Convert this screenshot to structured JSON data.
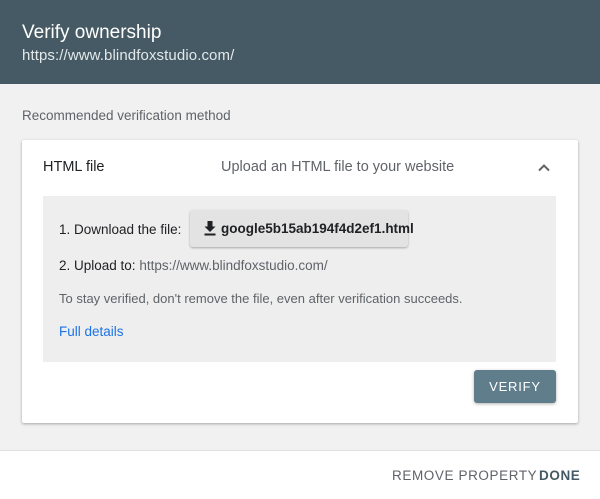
{
  "dialog": {
    "title": "Verify ownership",
    "property_url": "https://www.blindfoxstudio.com/"
  },
  "recommended_label": "Recommended verification method",
  "method": {
    "name": "HTML file",
    "description": "Upload an HTML file to your website",
    "expanded": true,
    "collapse_icon": "chevron-up-icon",
    "step1_label": "1. Download the file:",
    "download_file": "google5b15ab194f4d2ef1.html",
    "download_icon": "download-icon",
    "step2_label": "2. Upload to:",
    "step2_url": "https://www.blindfoxstudio.com/",
    "note": "To stay verified, don't remove the file, even after verification succeeds.",
    "details_link": "Full details",
    "verify_label": "VERIFY"
  },
  "footer": {
    "remove_label": "REMOVE PROPERTY",
    "done_label": "DONE"
  },
  "colors": {
    "header_bg": "#455a64",
    "verify_bg": "#607d8b",
    "link": "#1a73e8"
  }
}
